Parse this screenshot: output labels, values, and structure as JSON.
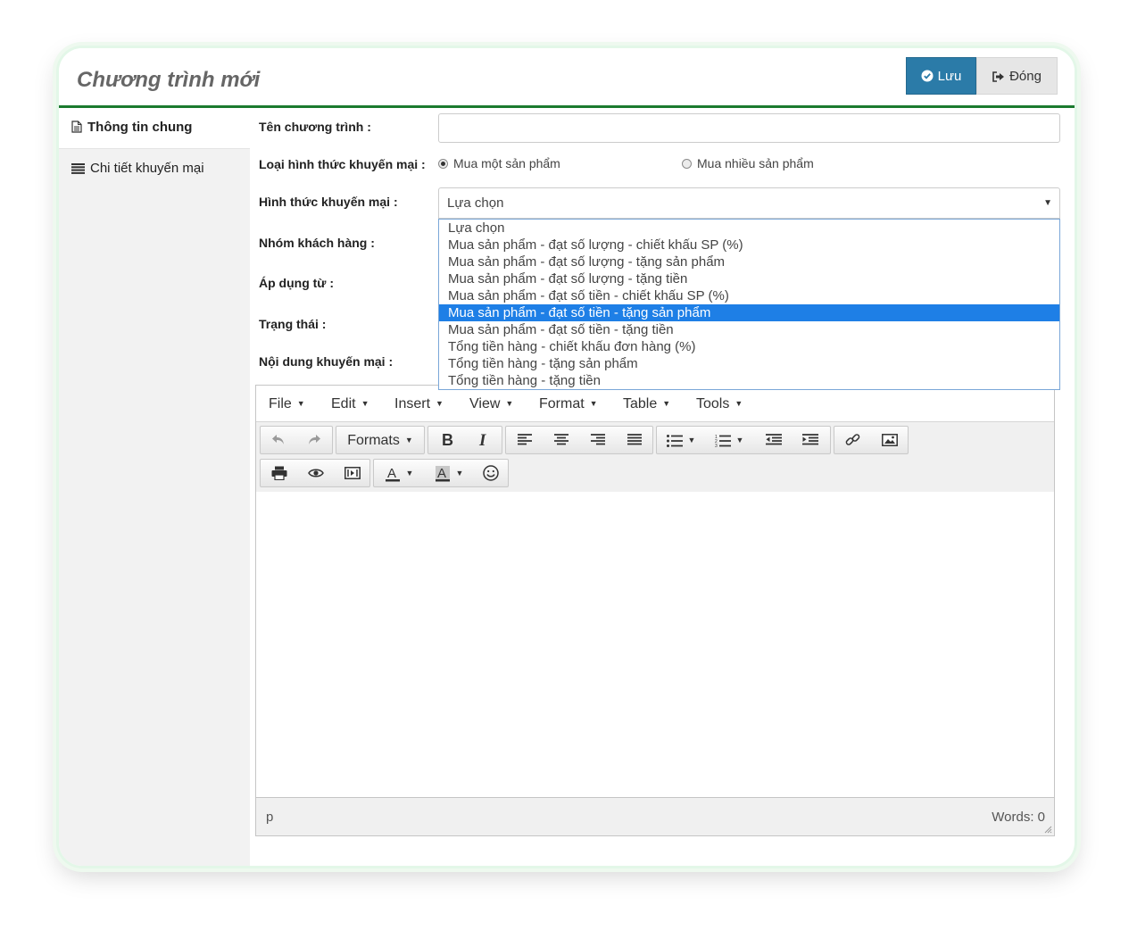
{
  "header": {
    "title": "Chương trình mới",
    "save_label": "Lưu",
    "close_label": "Đóng"
  },
  "sidebar": {
    "items": [
      {
        "label": "Thông tin chung",
        "active": true,
        "icon": "document-icon"
      },
      {
        "label": "Chi tiết khuyến mại",
        "active": false,
        "icon": "list-icon"
      }
    ]
  },
  "form": {
    "name_label": "Tên chương trình :",
    "name_value": "",
    "type_label": "Loại hình thức khuyến mại :",
    "type_options": [
      "Mua một sản phẩm",
      "Mua nhiều sản phẩm"
    ],
    "type_selected": "Mua một sản phẩm",
    "method_label": "Hình thức khuyến mại :",
    "method_value": "Lựa chọn",
    "customer_group_label": "Nhóm khách hàng :",
    "apply_from_label": "Áp dụng từ :",
    "status_label": "Trạng thái :",
    "content_label": "Nội dung khuyến mại :"
  },
  "dropdown": {
    "options": [
      "Lựa chọn",
      "Mua sản phẩm - đạt số lượng - chiết khấu SP (%)",
      "Mua sản phẩm - đạt số lượng - tặng sản phẩm",
      "Mua sản phẩm - đạt số lượng - tặng tiền",
      "Mua sản phẩm - đạt số tiền - chiết khấu SP (%)",
      "Mua sản phẩm - đạt số tiền - tặng sản phẩm",
      "Mua sản phẩm - đạt số tiền - tặng tiền",
      "Tổng tiền hàng - chiết khấu đơn hàng (%)",
      "Tổng tiền hàng - tặng sản phẩm",
      "Tổng tiền hàng - tặng tiền"
    ],
    "highlighted": "Mua sản phẩm - đạt số tiền - tặng sản phẩm"
  },
  "editor": {
    "menus": [
      "File",
      "Edit",
      "Insert",
      "View",
      "Format",
      "Table",
      "Tools"
    ],
    "formats_label": "Formats",
    "path": "p",
    "word_count": "Words: 0"
  },
  "colors": {
    "accent_green": "#1a7a2e",
    "save_button": "#2b7ba8",
    "highlight": "#1e7fe6"
  }
}
